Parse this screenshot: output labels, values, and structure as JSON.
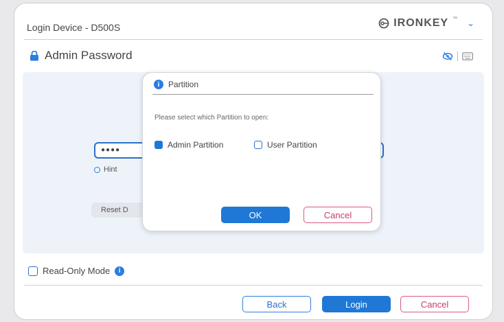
{
  "window": {
    "title": "Login Device - D500S",
    "brand": "IRONKEY",
    "brand_mark": "™"
  },
  "admin": {
    "heading": "Admin Password",
    "password_mask": "●●●●",
    "hint_label": "Hint",
    "reset_label": "Reset D",
    "read_only_label": "Read-Only Mode"
  },
  "footer": {
    "back_label": "Back",
    "login_label": "Login",
    "cancel_label": "Cancel"
  },
  "dialog": {
    "title": "Partition",
    "prompt": "Please select which Partition to open:",
    "options": [
      {
        "label": "Admin Partition",
        "checked": true
      },
      {
        "label": "User Partition",
        "checked": false
      }
    ],
    "ok_label": "OK",
    "cancel_label": "Cancel"
  },
  "colors": {
    "accent": "#1f78d6",
    "cancel": "#d8578a",
    "panel": "#eef3fa"
  },
  "icons": {
    "lock": "lock-icon",
    "brand": "ironkey-logo-icon",
    "chevron": "chevron-down-icon",
    "visibility": "eye-off-icon",
    "keyboard": "keyboard-icon",
    "info": "info-icon"
  }
}
